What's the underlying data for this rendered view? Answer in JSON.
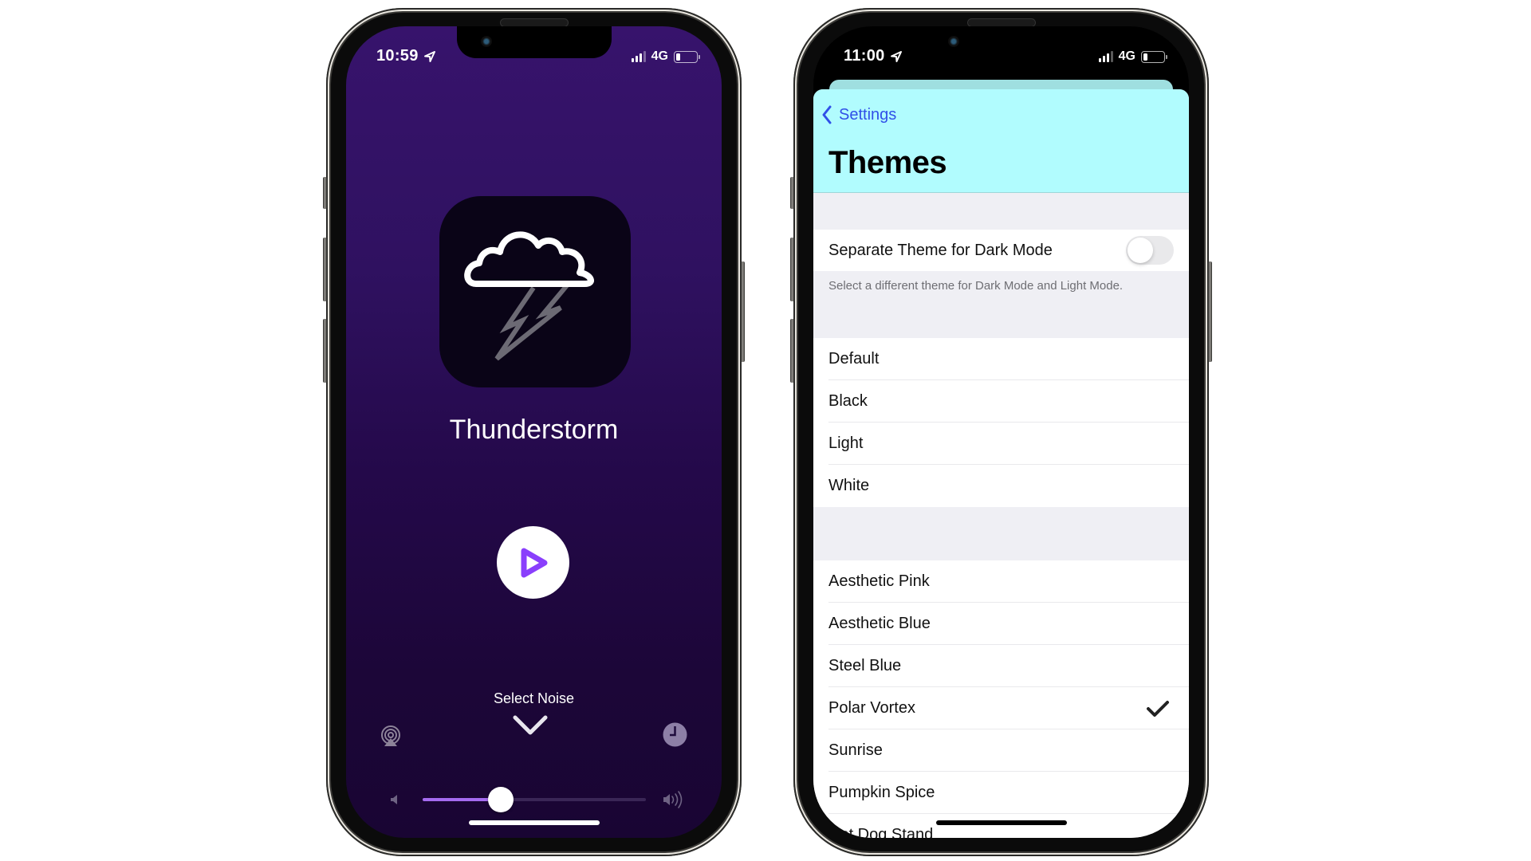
{
  "left_phone": {
    "status_bar": {
      "time": "10:59",
      "network": "4G",
      "signal_bars": 3,
      "signal_bars_total": 4,
      "battery_level": 0.15
    },
    "noise": {
      "title": "Thunderstorm",
      "icon": "thunderstorm-cloud-icon"
    },
    "controls": {
      "play_icon": "play-icon",
      "select_label": "Select Noise",
      "select_icon": "chevron-down-icon",
      "airplay_icon": "airplay-icon",
      "timer_icon": "timer-clock-icon",
      "volume_min_icon": "speaker-low-icon",
      "volume_max_icon": "speaker-high-icon",
      "volume_level": 0.35
    },
    "colors": {
      "gradient_top": "#37136c",
      "gradient_bottom": "#190533",
      "accent": "#8a3ffc",
      "slider_fill": "#a56bf0"
    }
  },
  "right_phone": {
    "status_bar": {
      "time": "11:00",
      "network": "4G",
      "signal_bars": 3,
      "signal_bars_total": 4,
      "battery_level": 0.15
    },
    "nav": {
      "back_label": "Settings",
      "title": "Themes"
    },
    "dark_mode_toggle": {
      "label": "Separate Theme for Dark Mode",
      "on": false,
      "footer": "Select a different theme for Dark Mode and Light Mode."
    },
    "theme_sections": [
      {
        "items": [
          "Default",
          "Black",
          "Light",
          "White"
        ]
      },
      {
        "items": [
          "Aesthetic Pink",
          "Aesthetic Blue",
          "Steel Blue",
          "Polar Vortex",
          "Sunrise",
          "Pumpkin Spice",
          "Hot Dog Stand"
        ]
      }
    ],
    "selected_theme": "Polar Vortex",
    "colors": {
      "header_bg": "#b1fcfe",
      "tint": "#3050e8",
      "grouped_bg": "#efeff4"
    }
  }
}
